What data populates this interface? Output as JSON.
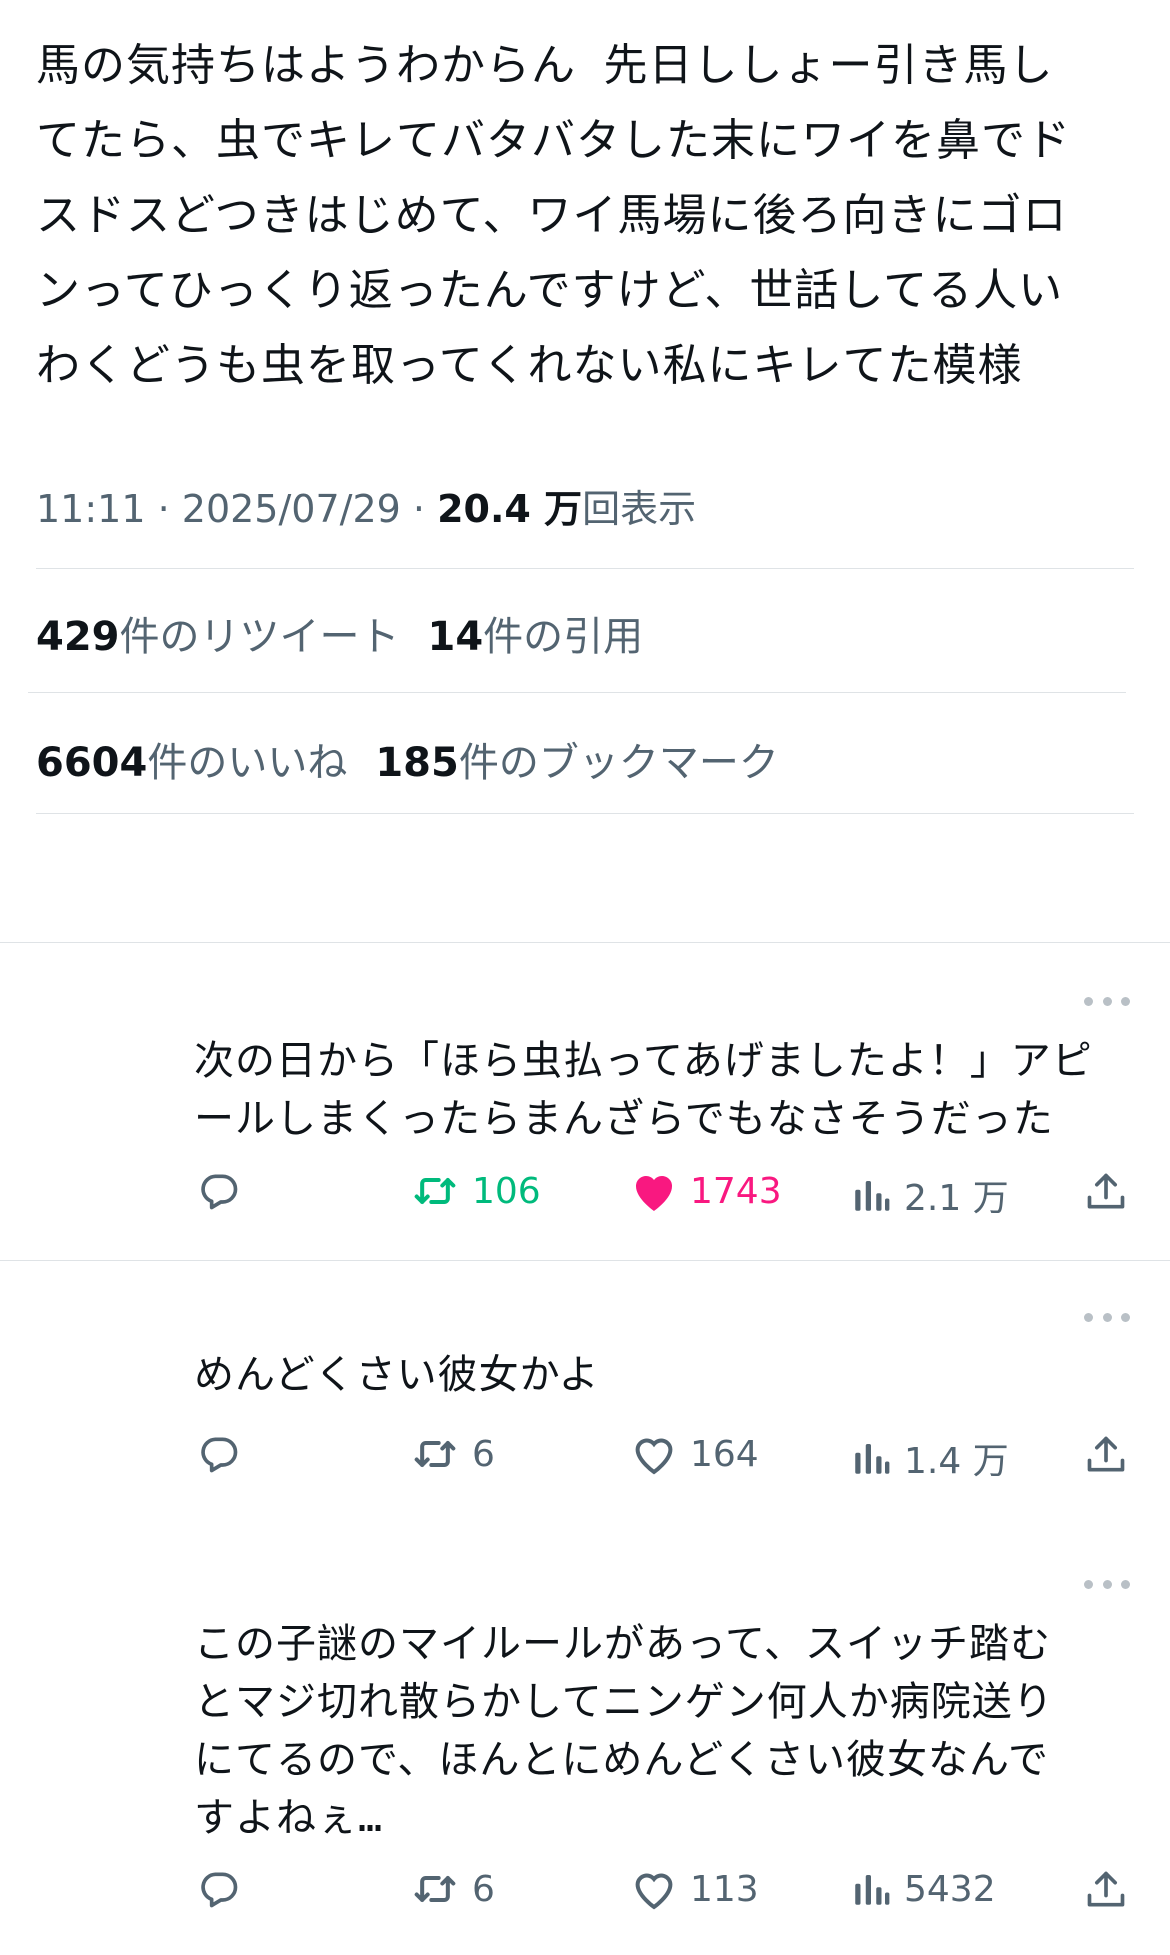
{
  "tweet": {
    "text": "馬の気持ちはようわからん 先日ししょー引き馬し\nてたら、虫でキレてバタバタした末にワイを鼻でド\nスドスどつきはじめて、ワイ馬場に後ろ向きにゴロ\nンってひっくり返ったんですけど、世話してる人い\nわくどうも虫を取ってくれない私にキレてた模様",
    "time": "11:11",
    "date": "2025/07/29",
    "views_count": "20.4 万",
    "views_label": "回表示"
  },
  "stats": {
    "retweets_count": "429",
    "retweets_label": "件のリツイート",
    "quotes_count": "14",
    "quotes_label": "件の引用",
    "likes_count": "6604",
    "likes_label": "件のいいね",
    "bookmarks_count": "185",
    "bookmarks_label": "件のブックマーク"
  },
  "colors": {
    "retweet_active": "#00ba7c",
    "like_active": "#f91880",
    "muted": "#536471"
  },
  "replies": [
    {
      "text": "次の日から「ほら虫払ってあげましたよ！」アピ\nールしまくったらまんざらでもなさそうだった",
      "retweets": "106",
      "likes": "1743",
      "views": "2.1 万",
      "retweeted": true,
      "liked": true
    },
    {
      "text": "めんどくさい彼女かよ",
      "retweets": "6",
      "likes": "164",
      "views": "1.4 万",
      "retweeted": false,
      "liked": false
    },
    {
      "text": "この子謎のマイルールがあって、スイッチ踏む\nとマジ切れ散らかしてニンゲン何人か病院送り\nにてるので、ほんとにめんどくさい彼女なんで\nすよねぇ…",
      "retweets": "6",
      "likes": "113",
      "views": "5432",
      "retweeted": false,
      "liked": false
    }
  ],
  "icons": [
    "more-icon",
    "reply-icon",
    "retweet-icon",
    "like-icon",
    "views-icon",
    "share-icon"
  ]
}
